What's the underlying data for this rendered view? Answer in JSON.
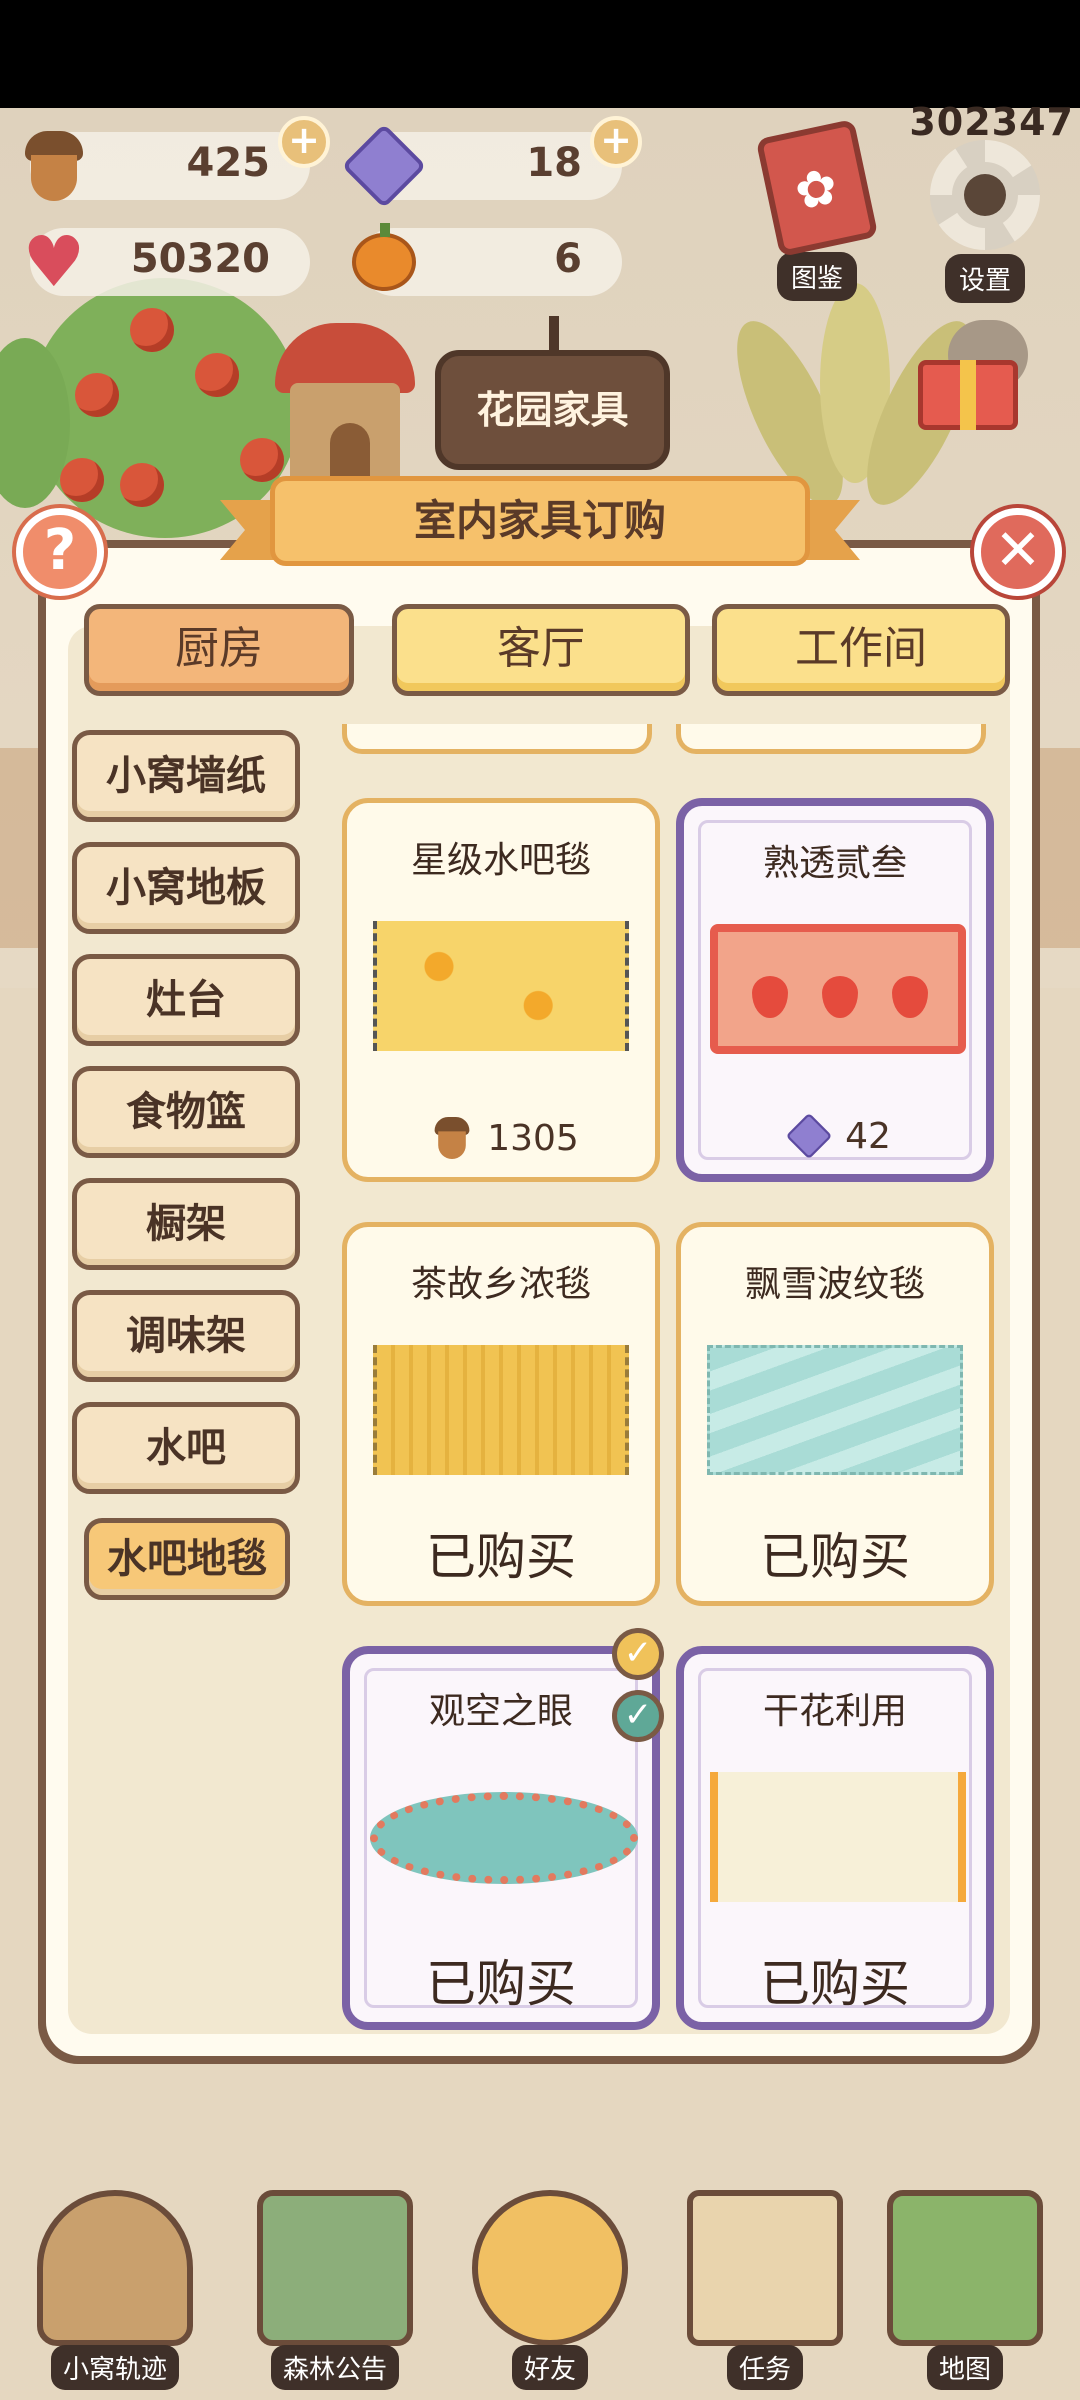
{
  "header": {
    "score": "302347",
    "resources": {
      "acorns": "425",
      "gems": "18",
      "hearts": "50320",
      "pumpkins": "6"
    },
    "side_buttons": {
      "codex": "图鉴",
      "settings": "设置"
    }
  },
  "background": {
    "garden_sign": "花园家具"
  },
  "modal": {
    "title": "室内家具订购",
    "help_symbol": "?",
    "close_symbol": "✕",
    "tabs": [
      {
        "label": "厨房",
        "active": true
      },
      {
        "label": "客厅",
        "active": false
      },
      {
        "label": "工作间",
        "active": false
      }
    ],
    "categories": [
      {
        "label": "小窝墙纸"
      },
      {
        "label": "小窝地板"
      },
      {
        "label": "灶台"
      },
      {
        "label": "食物篮"
      },
      {
        "label": "橱架"
      },
      {
        "label": "调味架"
      },
      {
        "label": "水吧"
      },
      {
        "label": "水吧地毯",
        "active": true
      }
    ],
    "items": [
      {
        "name": "星级水吧毯",
        "price": "1305",
        "currency": "acorn"
      },
      {
        "name": "熟透贰叁",
        "price": "42",
        "currency": "gem"
      },
      {
        "name": "茶故乡浓毯",
        "status": "已购买"
      },
      {
        "name": "飘雪波纹毯",
        "status": "已购买"
      },
      {
        "name": "观空之眼",
        "status": "已购买"
      },
      {
        "name": "干花利用",
        "status": "已购买"
      }
    ]
  },
  "bottom_nav": [
    {
      "label": "小窝轨迹"
    },
    {
      "label": "森林公告"
    },
    {
      "label": "好友"
    },
    {
      "label": "任务"
    },
    {
      "label": "地图"
    }
  ],
  "colors": {
    "accent": "#f6c16b",
    "rare_border": "#7b62a6",
    "common_border": "#e4b262",
    "frame": "#7a5a45"
  }
}
